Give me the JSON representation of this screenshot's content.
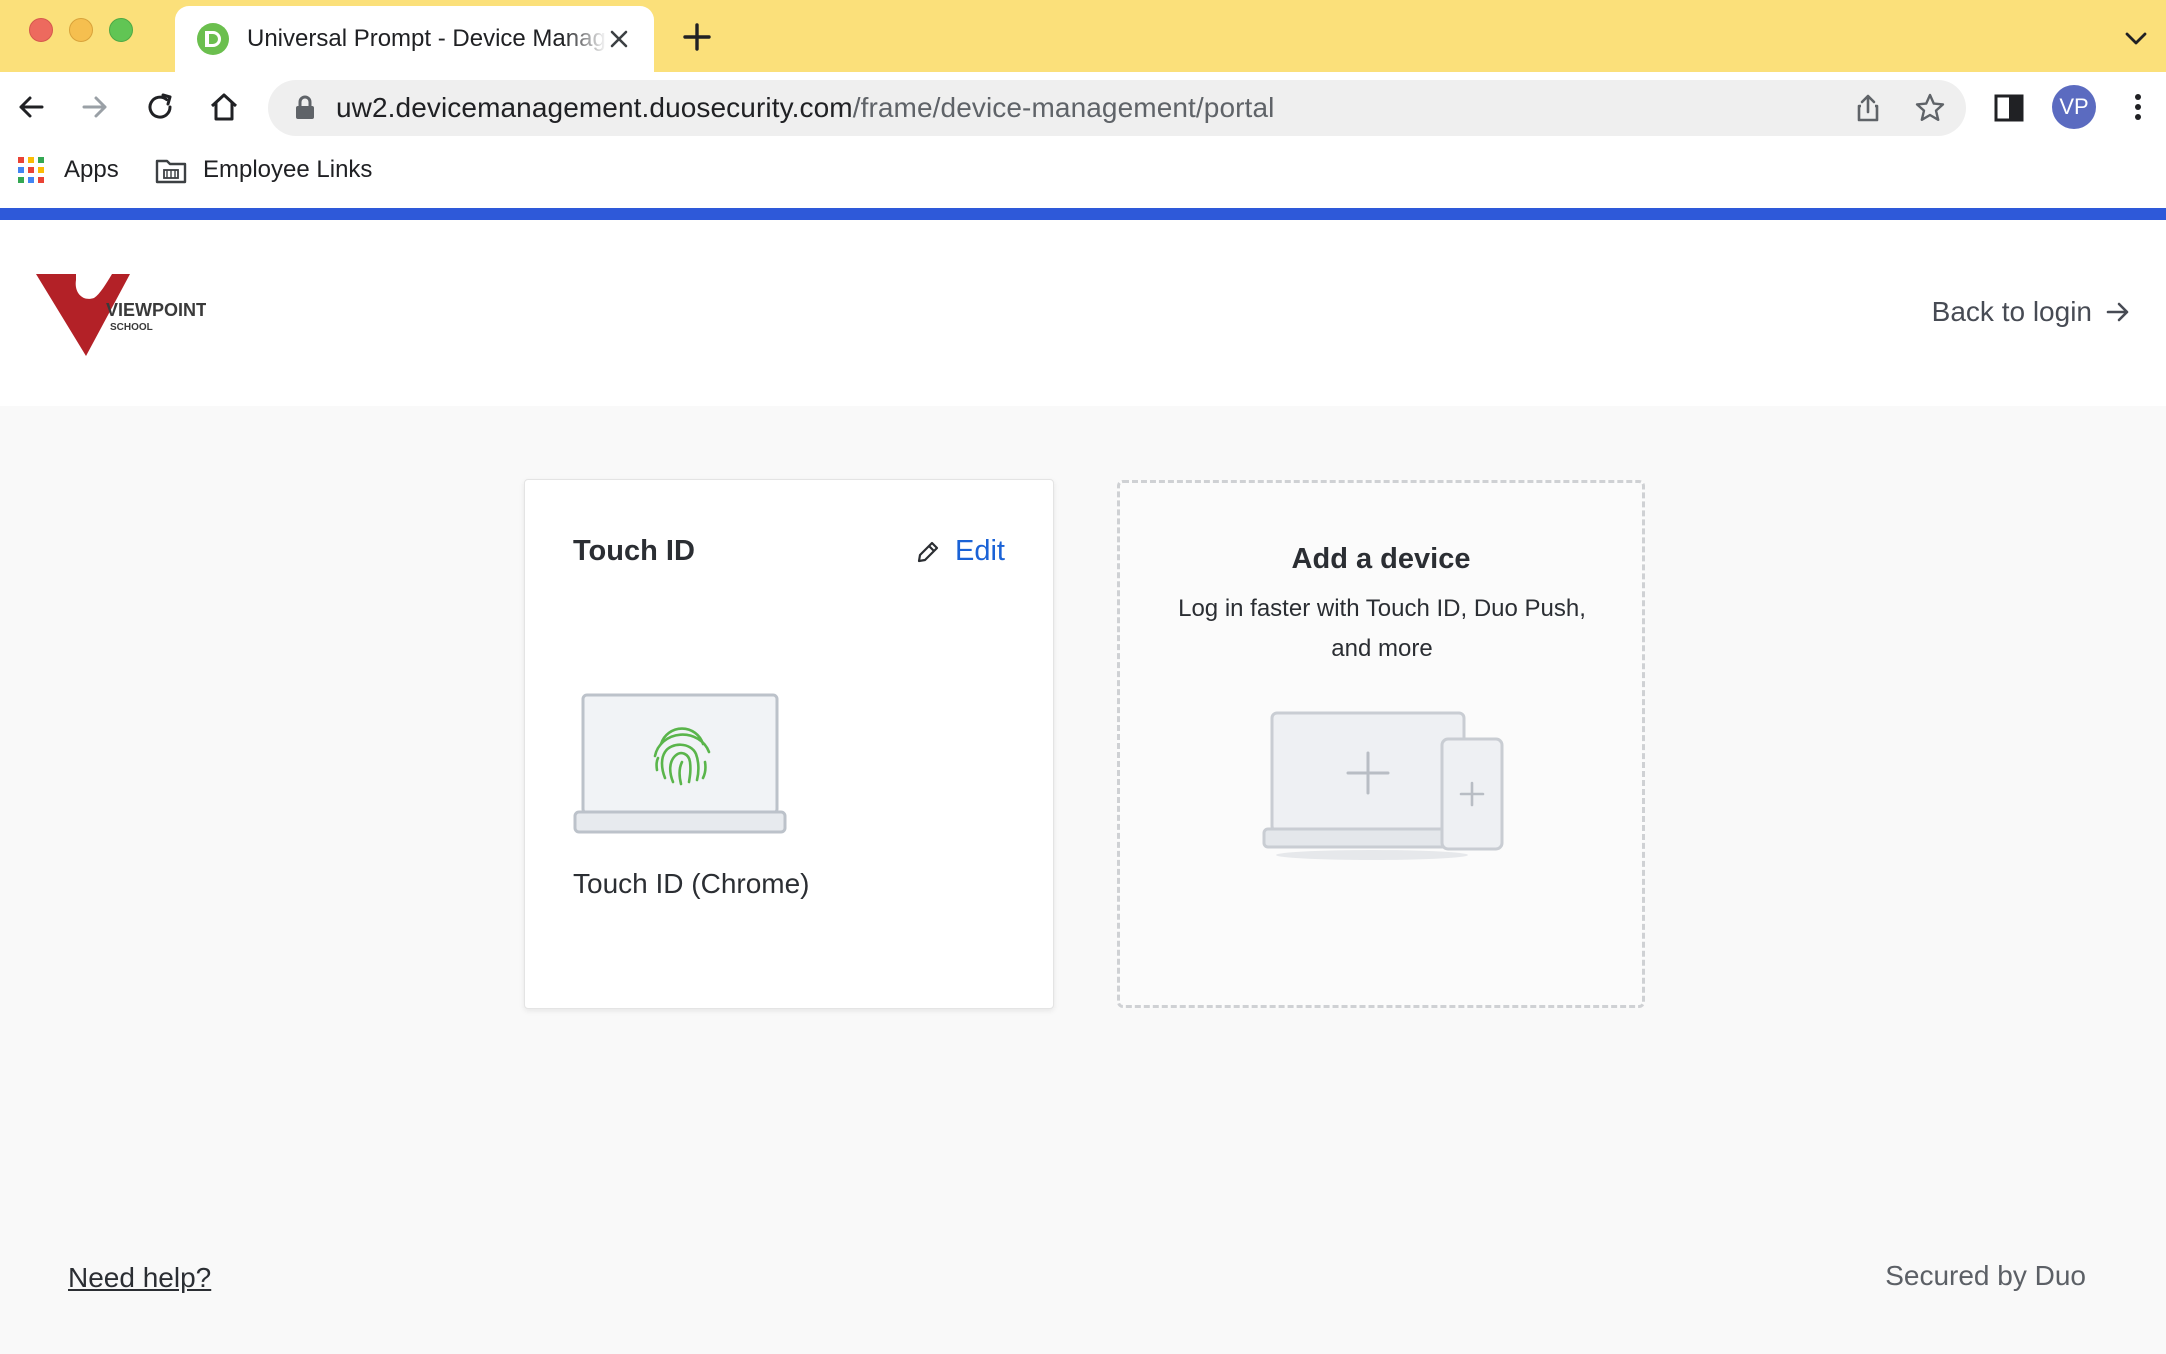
{
  "browser": {
    "tab_title": "Universal Prompt - Device Management",
    "url_host": "uw2.devicemanagement.duosecurity.com",
    "url_path": "/frame/device-management/portal",
    "profile_initials": "VP",
    "bookmarks": [
      {
        "label": "Apps",
        "icon": "apps-grid-icon"
      },
      {
        "label": "Employee Links",
        "icon": "folder-icon"
      }
    ],
    "accent_color": "#2e59d9",
    "tabbar_color": "#fbe07a"
  },
  "header": {
    "logo_text": "VIEWPOINT",
    "logo_subtext": "SCHOOL",
    "back_to_login": "Back to login"
  },
  "devices": [
    {
      "type_label": "Touch ID",
      "edit_label": "Edit",
      "name": "Touch ID (Chrome)",
      "icon": "fingerprint-icon"
    }
  ],
  "add_device": {
    "title": "Add a device",
    "subtitle": "Log in faster with Touch ID, Duo Push, and more"
  },
  "footer": {
    "help": "Need help?",
    "secured": "Secured by Duo"
  }
}
